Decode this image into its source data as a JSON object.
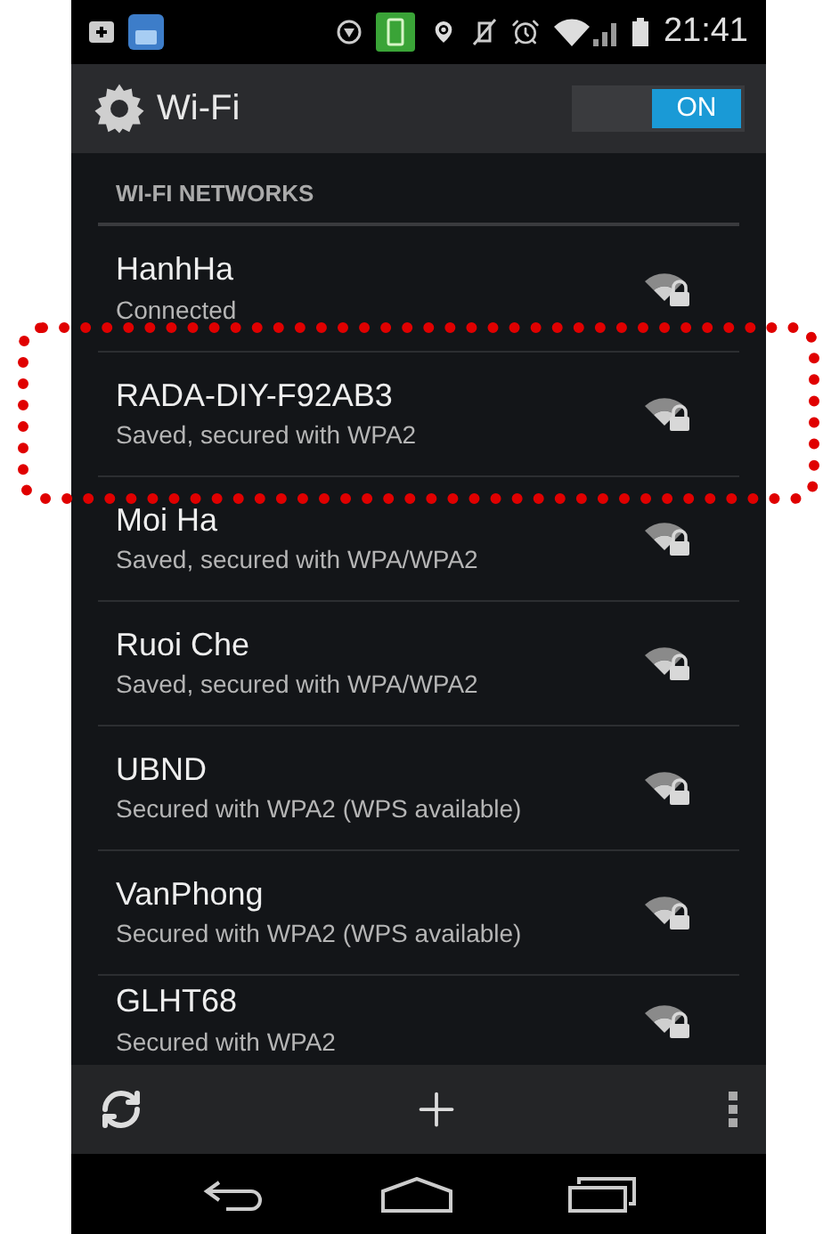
{
  "status_bar": {
    "time": "21:41"
  },
  "action_bar": {
    "title": "Wi-Fi",
    "toggle": {
      "label": "ON",
      "on": true
    }
  },
  "section_header": "WI-FI NETWORKS",
  "networks": [
    {
      "name": "HanhHa",
      "status": "Connected",
      "highlighted": false
    },
    {
      "name": "RADA-DIY-F92AB3",
      "status": "Saved, secured with WPA2",
      "highlighted": true
    },
    {
      "name": "Moi Ha",
      "status": "Saved, secured with WPA/WPA2",
      "highlighted": false
    },
    {
      "name": "Ruoi Che",
      "status": "Saved, secured with WPA/WPA2",
      "highlighted": false
    },
    {
      "name": "UBND",
      "status": "Secured with WPA2 (WPS available)",
      "highlighted": false
    },
    {
      "name": "VanPhong",
      "status": "Secured with WPA2 (WPS available)",
      "highlighted": false
    },
    {
      "name": "GLHT68",
      "status": "Secured with WPA2",
      "highlighted": false
    }
  ]
}
